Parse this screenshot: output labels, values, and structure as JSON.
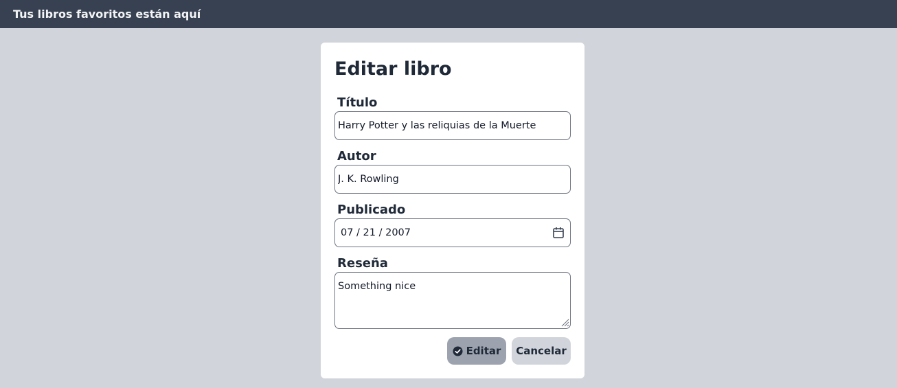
{
  "header": {
    "title": "Tus libros favoritos están aquí"
  },
  "form": {
    "heading": "Editar libro",
    "titulo": {
      "label": "Título",
      "value": "Harry Potter y las reliquias de la Muerte"
    },
    "autor": {
      "label": "Autor",
      "value": "J. K. Rowling"
    },
    "publicado": {
      "label": "Publicado",
      "value": "07 / 21 / 2007",
      "icon": "calendar-icon"
    },
    "resena": {
      "label": "Reseña",
      "value": "Something nice"
    },
    "buttons": {
      "edit_label": "Editar",
      "edit_icon": "check-circle-icon",
      "cancel_label": "Cancelar"
    }
  },
  "colors": {
    "topbar": "#374151",
    "background": "#d1d5db",
    "card": "#ffffff",
    "edit_button": "#9ca3af",
    "cancel_button": "#d1d5db",
    "text": "#1f2937"
  }
}
